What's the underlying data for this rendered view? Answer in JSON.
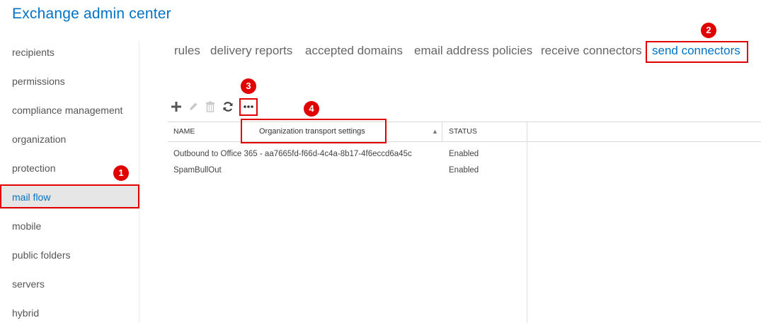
{
  "app": {
    "title": "Exchange admin center"
  },
  "sidebar": {
    "items": [
      {
        "label": "recipients"
      },
      {
        "label": "permissions"
      },
      {
        "label": "compliance management"
      },
      {
        "label": "organization"
      },
      {
        "label": "protection"
      },
      {
        "label": "mail flow"
      },
      {
        "label": "mobile"
      },
      {
        "label": "public folders"
      },
      {
        "label": "servers"
      },
      {
        "label": "hybrid"
      }
    ],
    "active": "mail flow"
  },
  "tabs": [
    {
      "label": "rules"
    },
    {
      "label": "delivery reports"
    },
    {
      "label": "accepted domains"
    },
    {
      "label": "email address policies"
    },
    {
      "label": "receive connectors"
    },
    {
      "label": "send connectors"
    }
  ],
  "active_tab": "send connectors",
  "toolbar": {
    "add_icon": "plus-icon",
    "edit_icon": "pencil-icon",
    "delete_icon": "trash-icon",
    "refresh_icon": "refresh-icon",
    "more_icon": "ellipsis-icon"
  },
  "table": {
    "columns": [
      "NAME",
      "STATUS"
    ],
    "dropdown_label": "Organization transport settings",
    "rows": [
      {
        "name": "Outbound to Office 365 - aa7665fd-f66d-4c4a-8b17-4f6eccd6a45c",
        "status": "Enabled"
      },
      {
        "name": "SpamBullOut",
        "status": "Enabled"
      }
    ]
  },
  "callouts": [
    "1",
    "2",
    "3",
    "4"
  ],
  "colors": {
    "accent": "#0072c6",
    "highlight": "#e00000"
  }
}
